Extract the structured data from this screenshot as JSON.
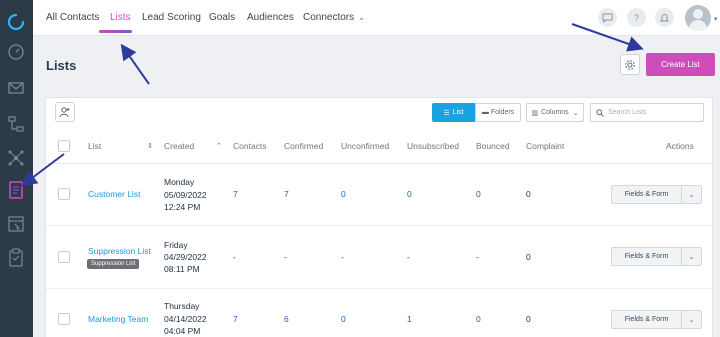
{
  "nav": {
    "tabs": [
      "All Contacts",
      "Lists",
      "Lead Scoring",
      "Goals",
      "Audiences",
      "Connectors"
    ],
    "active": "Lists"
  },
  "page": {
    "title": "Lists",
    "create_label": "Create List"
  },
  "toolbar": {
    "view_list": "List",
    "view_folders": "Folders",
    "columns": "Columns",
    "search_placeholder": "Search Lists"
  },
  "table": {
    "headers": [
      "List",
      "Created",
      "Contacts",
      "Confirmed",
      "Unconfirmed",
      "Unsubscribed",
      "Bounced",
      "Complaint",
      "Actions"
    ],
    "rows": [
      {
        "name": "Customer List",
        "day": "Monday",
        "date": "05/09/2022",
        "time": "12:24 PM",
        "contacts": "7",
        "confirmed": "7",
        "unconfirmed": "0",
        "unsubscribed": "0",
        "bounced": "0",
        "complaint": "0",
        "badge": ""
      },
      {
        "name": "Suppression List",
        "day": "Friday",
        "date": "04/29/2022",
        "time": "08:11 PM",
        "contacts": "-",
        "confirmed": "-",
        "unconfirmed": "-",
        "unsubscribed": "-",
        "bounced": "-",
        "complaint": "0",
        "badge": "Suppression List"
      },
      {
        "name": "Marketing Team",
        "day": "Thursday",
        "date": "04/14/2022",
        "time": "04:04 PM",
        "contacts": "7",
        "confirmed": "6",
        "unconfirmed": "0",
        "unsubscribed": "1",
        "bounced": "0",
        "complaint": "0",
        "badge": ""
      }
    ],
    "action_label": "Fields & Form"
  },
  "colors": {
    "accent": "#cf4db8",
    "primary_blue": "#1aa3e0",
    "rail": "#2d3a47",
    "arrow": "#2f3a9e"
  }
}
